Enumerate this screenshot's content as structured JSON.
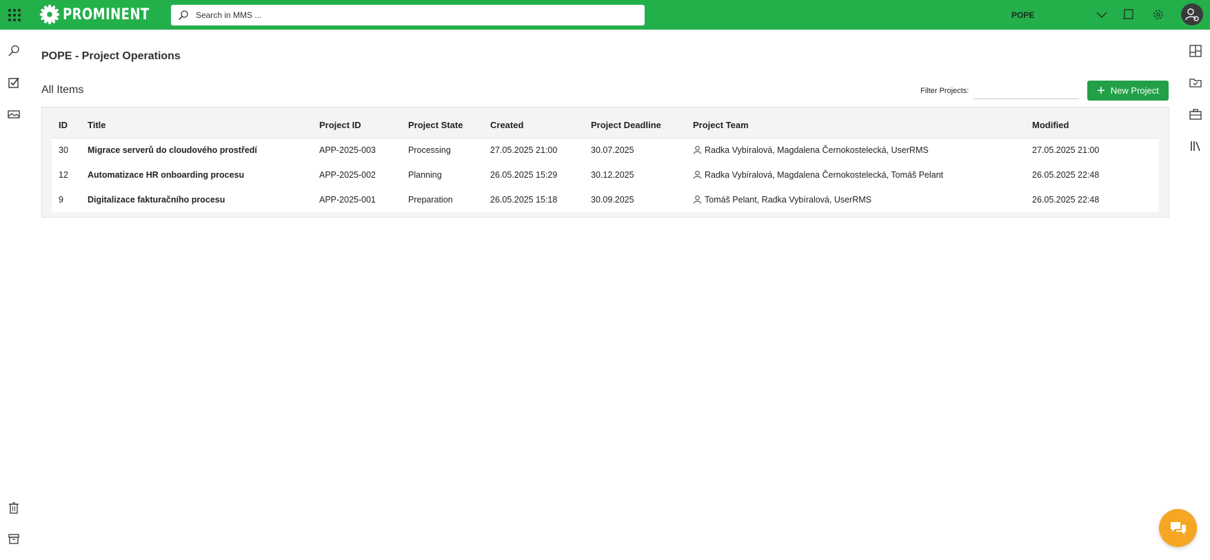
{
  "topbar": {
    "brand": "PROMINENT",
    "search_placeholder": "Search in MMS ...",
    "site": "POPE",
    "accent_color": "#23b04b",
    "icons": [
      "app-launcher-icon",
      "search-icon",
      "chevron-down-icon",
      "tablet-icon",
      "gear-icon",
      "user-settings-icon"
    ]
  },
  "left_rail": {
    "icons": [
      "search-icon",
      "checkbox-icon",
      "image-icon",
      "trash-icon",
      "archive-icon"
    ]
  },
  "right_rail": {
    "icons": [
      "layout-icon",
      "inbox-icon",
      "briefcase-icon",
      "library-icon"
    ]
  },
  "page": {
    "title": "POPE - Project Operations",
    "view_title": "All Items",
    "filter_label": "Filter Projects:",
    "filter_value": "",
    "new_button": "New Project"
  },
  "table": {
    "columns": [
      "ID",
      "Title",
      "Project ID",
      "Project State",
      "Created",
      "Project Deadline",
      "Project Team",
      "Modified"
    ],
    "rows": [
      {
        "id": "30",
        "title": "Migrace serverů do cloudového prostředí",
        "project_id": "APP-2025-003",
        "state": "Processing",
        "created": "27.05.2025 21:00",
        "deadline": "30.07.2025",
        "team": "Radka Vybíralová, Magdalena Černokostelecká, UserRMS",
        "modified": "27.05.2025 21:00"
      },
      {
        "id": "12",
        "title": "Automatizace HR onboarding procesu",
        "project_id": "APP-2025-002",
        "state": "Planning",
        "created": "26.05.2025 15:29",
        "deadline": "30.12.2025",
        "team": "Radka Vybíralová, Magdalena Černokostelecká, Tomáš Pelant",
        "modified": "26.05.2025 22:48"
      },
      {
        "id": "9",
        "title": "Digitalizace fakturačního procesu",
        "project_id": "APP-2025-001",
        "state": "Preparation",
        "created": "26.05.2025 15:18",
        "deadline": "30.09.2025",
        "team": "Tomáš Pelant, Radka Vybíralová, UserRMS",
        "modified": "26.05.2025 22:48"
      }
    ]
  },
  "chat": {
    "icon": "chat-bubbles-icon",
    "color": "#f5a623"
  }
}
